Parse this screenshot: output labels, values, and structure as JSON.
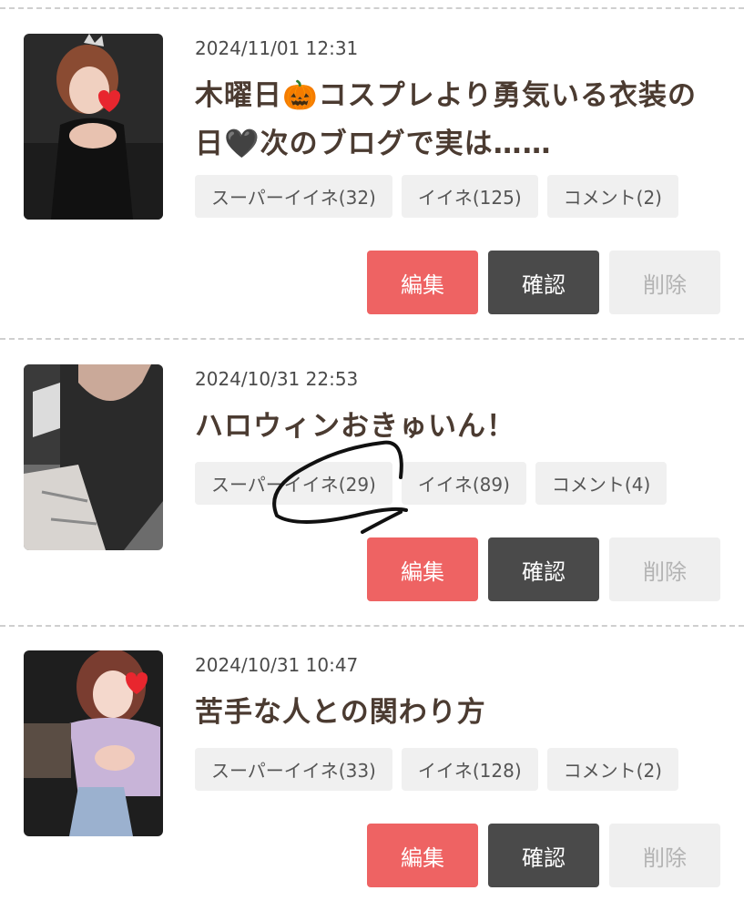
{
  "posts": [
    {
      "date": "2024/11/01 12:31",
      "title": "木曜日🎃コスプレより勇気いる衣装の日🖤次のブログで実は……",
      "tags": {
        "super_like": "スーパーイイネ(32)",
        "like": "イイネ(125)",
        "comment": "コメント(2)"
      }
    },
    {
      "date": "2024/10/31 22:53",
      "title": "ハロウィンおきゅいん！",
      "tags": {
        "super_like": "スーパーイイネ(29)",
        "like": "イイネ(89)",
        "comment": "コメント(4)"
      }
    },
    {
      "date": "2024/10/31 10:47",
      "title": "苦手な人との関わり方",
      "tags": {
        "super_like": "スーパーイイネ(33)",
        "like": "イイネ(128)",
        "comment": "コメント(2)"
      }
    }
  ],
  "actions": {
    "edit": "編集",
    "confirm": "確認",
    "delete": "削除"
  },
  "colors": {
    "edit_button": "#ee6363",
    "confirm_button": "#4a4a4a",
    "delete_button": "#efefef",
    "tag_background": "#f0f0f0",
    "title_text": "#4b3b31"
  }
}
